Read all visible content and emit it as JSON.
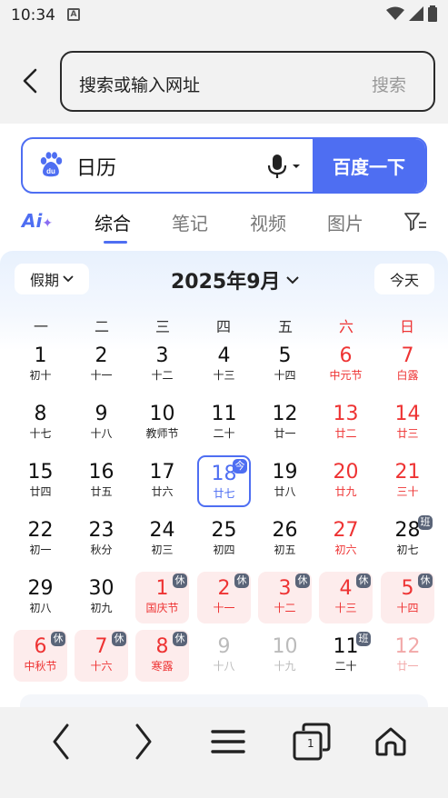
{
  "status_bar": {
    "time": "10:34",
    "notification_icon": "A"
  },
  "address_bar": {
    "placeholder": "搜索或输入网址",
    "search_label": "搜索"
  },
  "search_box": {
    "query": "日历",
    "button": "百度一下"
  },
  "tabs": {
    "ai": "Ai",
    "items": [
      "综合",
      "笔记",
      "视频",
      "图片"
    ],
    "active": "综合"
  },
  "calendar": {
    "holiday_button": "假期",
    "month": "2025年9月",
    "today_button": "今天",
    "weekdays": [
      "一",
      "二",
      "三",
      "四",
      "五",
      "六",
      "日"
    ],
    "days": [
      {
        "d": "1",
        "l": "初十"
      },
      {
        "d": "2",
        "l": "十一"
      },
      {
        "d": "3",
        "l": "十二"
      },
      {
        "d": "4",
        "l": "十三"
      },
      {
        "d": "5",
        "l": "十四"
      },
      {
        "d": "6",
        "l": "中元节",
        "we": true
      },
      {
        "d": "7",
        "l": "白露",
        "we": true
      },
      {
        "d": "8",
        "l": "十七"
      },
      {
        "d": "9",
        "l": "十八"
      },
      {
        "d": "10",
        "l": "教师节"
      },
      {
        "d": "11",
        "l": "二十"
      },
      {
        "d": "12",
        "l": "廿一"
      },
      {
        "d": "13",
        "l": "廿二",
        "we": true
      },
      {
        "d": "14",
        "l": "廿三",
        "we": true
      },
      {
        "d": "15",
        "l": "廿四"
      },
      {
        "d": "16",
        "l": "廿五"
      },
      {
        "d": "17",
        "l": "廿六"
      },
      {
        "d": "18",
        "l": "廿七",
        "today": true,
        "badge": "今"
      },
      {
        "d": "19",
        "l": "廿八"
      },
      {
        "d": "20",
        "l": "廿九",
        "we": true
      },
      {
        "d": "21",
        "l": "三十",
        "we": true
      },
      {
        "d": "22",
        "l": "初一"
      },
      {
        "d": "23",
        "l": "秋分"
      },
      {
        "d": "24",
        "l": "初三"
      },
      {
        "d": "25",
        "l": "初四"
      },
      {
        "d": "26",
        "l": "初五"
      },
      {
        "d": "27",
        "l": "初六",
        "we": true
      },
      {
        "d": "28",
        "l": "初七",
        "badge": "班"
      },
      {
        "d": "29",
        "l": "初八"
      },
      {
        "d": "30",
        "l": "初九"
      },
      {
        "d": "1",
        "l": "国庆节",
        "rest": true,
        "badge": "休"
      },
      {
        "d": "2",
        "l": "十一",
        "rest": true,
        "badge": "休"
      },
      {
        "d": "3",
        "l": "十二",
        "rest": true,
        "badge": "休"
      },
      {
        "d": "4",
        "l": "十三",
        "rest": true,
        "badge": "休"
      },
      {
        "d": "5",
        "l": "十四",
        "rest": true,
        "badge": "休"
      },
      {
        "d": "6",
        "l": "中秋节",
        "rest": true,
        "badge": "休"
      },
      {
        "d": "7",
        "l": "十六",
        "rest": true,
        "badge": "休"
      },
      {
        "d": "8",
        "l": "寒露",
        "rest": true,
        "badge": "休"
      },
      {
        "d": "9",
        "l": "十八",
        "dim": true
      },
      {
        "d": "10",
        "l": "十九",
        "dim": true
      },
      {
        "d": "11",
        "l": "二十",
        "badge": "班"
      },
      {
        "d": "12",
        "l": "廿一",
        "dim": true,
        "we": true
      }
    ]
  },
  "bottom_bar": {
    "tab_count": "1"
  },
  "colors": {
    "accent": "#4e6ef2",
    "holiday_red": "#e33333",
    "rest_bg": "#fdecec",
    "workday_badge": "#5a6478"
  }
}
